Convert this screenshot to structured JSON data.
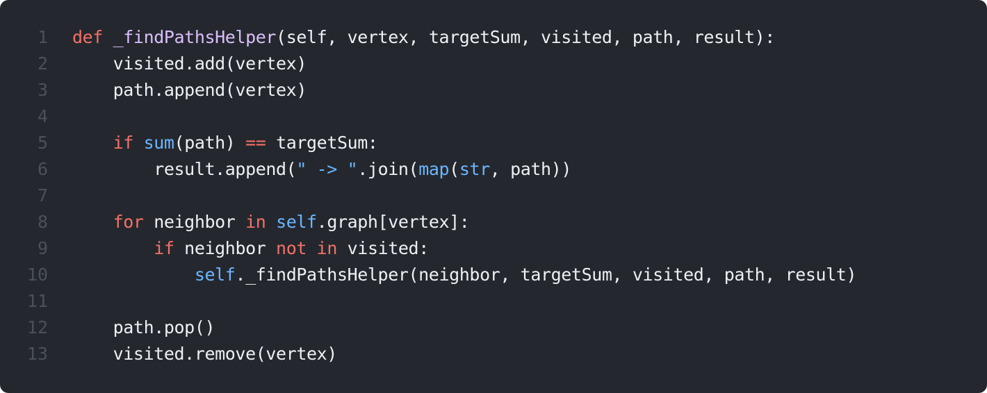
{
  "editor": {
    "background_color": "#24282e",
    "colors": {
      "text": "#eef0f3",
      "keyword": "#f47067",
      "builtin": "#6cb6ff",
      "function_name": "#dcbdfb",
      "line_number": "#4a5159"
    },
    "lines": [
      {
        "number": "1",
        "indent": "",
        "tokens": [
          {
            "text": "def",
            "kind": "kw"
          },
          {
            "text": " ",
            "kind": "txt"
          },
          {
            "text": "_findPathsHelper",
            "kind": "fn"
          },
          {
            "text": "(self, vertex, targetSum, visited, path, result):",
            "kind": "txt"
          }
        ]
      },
      {
        "number": "2",
        "indent": "    ",
        "tokens": [
          {
            "text": "visited.add(vertex)",
            "kind": "txt"
          }
        ]
      },
      {
        "number": "3",
        "indent": "    ",
        "tokens": [
          {
            "text": "path.append(vertex)",
            "kind": "txt"
          }
        ]
      },
      {
        "number": "4",
        "indent": "",
        "tokens": []
      },
      {
        "number": "5",
        "indent": "    ",
        "tokens": [
          {
            "text": "if",
            "kind": "kw"
          },
          {
            "text": " ",
            "kind": "txt"
          },
          {
            "text": "sum",
            "kind": "bi"
          },
          {
            "text": "(path) ",
            "kind": "txt"
          },
          {
            "text": "==",
            "kind": "kw"
          },
          {
            "text": " targetSum:",
            "kind": "txt"
          }
        ]
      },
      {
        "number": "6",
        "indent": "        ",
        "tokens": [
          {
            "text": "result.append(",
            "kind": "txt"
          },
          {
            "text": "\" -> \"",
            "kind": "bi"
          },
          {
            "text": ".join(",
            "kind": "txt"
          },
          {
            "text": "map",
            "kind": "bi"
          },
          {
            "text": "(",
            "kind": "txt"
          },
          {
            "text": "str",
            "kind": "bi"
          },
          {
            "text": ", path))",
            "kind": "txt"
          }
        ]
      },
      {
        "number": "7",
        "indent": "",
        "tokens": []
      },
      {
        "number": "8",
        "indent": "    ",
        "tokens": [
          {
            "text": "for",
            "kind": "kw"
          },
          {
            "text": " neighbor ",
            "kind": "txt"
          },
          {
            "text": "in",
            "kind": "kw"
          },
          {
            "text": " ",
            "kind": "txt"
          },
          {
            "text": "self",
            "kind": "bi"
          },
          {
            "text": ".graph[vertex]:",
            "kind": "txt"
          }
        ]
      },
      {
        "number": "9",
        "indent": "        ",
        "tokens": [
          {
            "text": "if",
            "kind": "kw"
          },
          {
            "text": " neighbor ",
            "kind": "txt"
          },
          {
            "text": "not",
            "kind": "kw"
          },
          {
            "text": " ",
            "kind": "txt"
          },
          {
            "text": "in",
            "kind": "kw"
          },
          {
            "text": " visited:",
            "kind": "txt"
          }
        ]
      },
      {
        "number": "10",
        "indent": "            ",
        "tokens": [
          {
            "text": "self",
            "kind": "bi"
          },
          {
            "text": "._findPathsHelper(neighbor, targetSum, visited, path, result)",
            "kind": "txt"
          }
        ]
      },
      {
        "number": "11",
        "indent": "",
        "tokens": []
      },
      {
        "number": "12",
        "indent": "    ",
        "tokens": [
          {
            "text": "path.pop()",
            "kind": "txt"
          }
        ]
      },
      {
        "number": "13",
        "indent": "    ",
        "tokens": [
          {
            "text": "visited.remove(vertex)",
            "kind": "txt"
          }
        ]
      }
    ]
  }
}
